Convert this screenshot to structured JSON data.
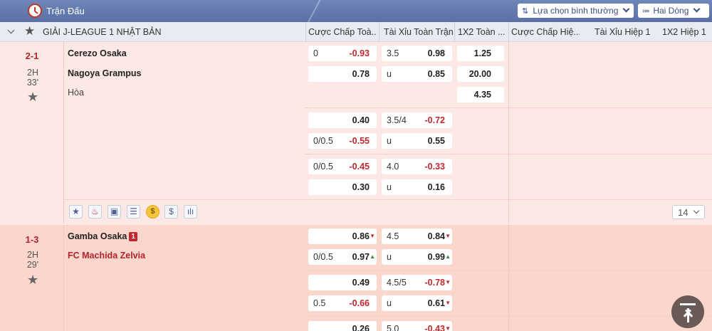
{
  "topbar": {
    "title": "Trận Đấu",
    "sort_label": "Lựa chọn bình thường",
    "lines_label": "Hai Dòng"
  },
  "header": {
    "league": "GIẢI J-LEAGUE 1 NHẬT BẢN",
    "columns": [
      "Cược Chấp Toà...",
      "Tài Xỉu Toàn Trận",
      "1X2 Toàn ...",
      "Cược Chấp Hiệ...",
      "Tài Xỉu Hiệp 1",
      "1X2 Hiệp 1"
    ]
  },
  "match1": {
    "score": "2-1",
    "period": "2H",
    "minute": "33'",
    "home": "Cerezo Osaka",
    "away": "Nagoya Grampus",
    "draw": "Hòa",
    "r1": {
      "h_line": "0",
      "h_home": "-0.93",
      "h_away": "0.78",
      "ou_line": "3.5",
      "ou_over": "0.98",
      "ou_u": "u",
      "ou_under": "0.85",
      "x_home": "1.25",
      "x_away": "20.00",
      "x_draw": "4.35"
    },
    "r2": {
      "h_home": "0.40",
      "h_line": "0/0.5",
      "h_away": "-0.55",
      "ou_line": "3.5/4",
      "ou_over": "-0.72",
      "ou_u": "u",
      "ou_under": "0.55"
    },
    "r3": {
      "h_line": "0/0.5",
      "h_home": "-0.45",
      "h_away": "0.30",
      "ou_line": "4.0",
      "ou_over": "-0.33",
      "ou_u": "u",
      "ou_under": "0.16"
    },
    "more_count": "14"
  },
  "match2": {
    "score": "1-3",
    "period": "2H",
    "minute": "29'",
    "home": "Gamba Osaka",
    "home_badge": "1",
    "away": "FC Machida Zelvia",
    "r1": {
      "h_home": "0.86",
      "h_line": "0/0.5",
      "h_away": "0.97",
      "ou_line": "4.5",
      "ou_over": "0.84",
      "ou_u": "u",
      "ou_under": "0.99"
    },
    "r2": {
      "h_home": "0.49",
      "h_line": "0.5",
      "h_away": "-0.66",
      "ou_line": "4.5/5",
      "ou_over": "-0.78",
      "ou_u": "u",
      "ou_under": "0.61"
    },
    "r3": {
      "h_home": "0.26",
      "ou_line": "5.0",
      "ou_over": "-0.43"
    }
  },
  "icons": {
    "coin_symbol": "$",
    "dollar_symbol": "$"
  },
  "colors": {
    "topbar": "#5f76ab",
    "negative": "#c0282d",
    "up": "#2e8b3c"
  }
}
